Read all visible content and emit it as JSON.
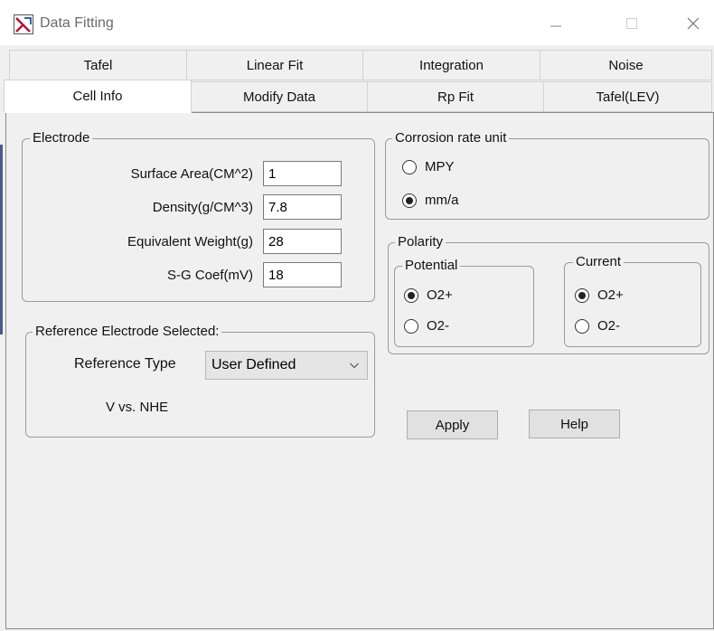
{
  "window": {
    "title": "Data Fitting"
  },
  "tabs_row1": [
    {
      "label": "Tafel"
    },
    {
      "label": "Linear Fit"
    },
    {
      "label": "Integration"
    },
    {
      "label": "Noise"
    }
  ],
  "tabs_row2": [
    {
      "label": "Cell Info",
      "selected": true
    },
    {
      "label": "Modify Data"
    },
    {
      "label": "Rp Fit"
    },
    {
      "label": "Tafel(LEV)"
    }
  ],
  "electrode": {
    "title": "Electrode",
    "fields": [
      {
        "label": "Surface Area(CM^2)",
        "value": "1"
      },
      {
        "label": "Density(g/CM^3)",
        "value": "7.8"
      },
      {
        "label": "Equivalent Weight(g)",
        "value": "28"
      },
      {
        "label": "S-G Coef(mV)",
        "value": "18"
      }
    ]
  },
  "reference": {
    "title": "Reference Electrode Selected:",
    "type_label": "Reference Type",
    "type_value": "User Defined",
    "vs_text": "V vs. NHE"
  },
  "corrosion": {
    "title": "Corrosion rate unit",
    "options": [
      {
        "label": "MPY",
        "checked": false
      },
      {
        "label": "mm/a",
        "checked": true
      }
    ]
  },
  "polarity": {
    "title": "Polarity",
    "potential": {
      "title": "Potential",
      "options": [
        {
          "label": "O2+",
          "checked": true
        },
        {
          "label": "O2-",
          "checked": false
        }
      ]
    },
    "current": {
      "title": "Current",
      "options": [
        {
          "label": "O2+",
          "checked": true
        },
        {
          "label": "O2-",
          "checked": false
        }
      ]
    }
  },
  "buttons": {
    "apply": "Apply",
    "help": "Help"
  },
  "icons": {
    "app": "data-fitting-app-icon",
    "minimize": "minimize-icon",
    "maximize": "maximize-icon",
    "close": "close-icon",
    "dropdown": "chevron-down-icon"
  },
  "colors": {
    "app_icon_accent": "#b0153a",
    "selected_radio": "#222222"
  }
}
